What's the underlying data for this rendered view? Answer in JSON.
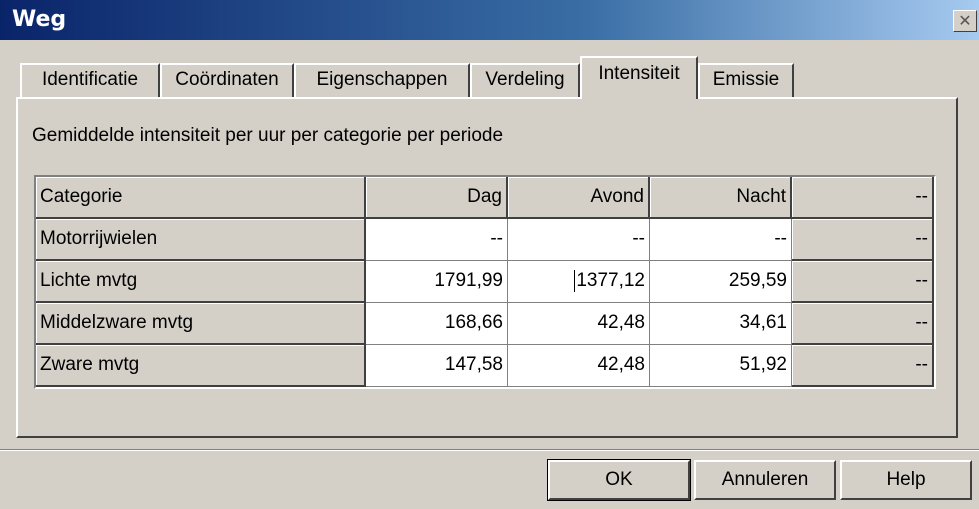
{
  "window": {
    "title": "Weg",
    "close_glyph": "✕"
  },
  "tabs": [
    {
      "label": "Identificatie",
      "active": false
    },
    {
      "label": "Coördinaten",
      "active": false
    },
    {
      "label": "Eigenschappen",
      "active": false
    },
    {
      "label": "Verdeling",
      "active": false
    },
    {
      "label": "Intensiteit",
      "active": true
    },
    {
      "label": "Emissie",
      "active": false
    }
  ],
  "panel": {
    "caption": "Gemiddelde intensiteit per uur per categorie per periode"
  },
  "table": {
    "headers": [
      "Categorie",
      "Dag",
      "Avond",
      "Nacht",
      "--"
    ],
    "rows": [
      {
        "category": "Motorrijwielen",
        "values": [
          "--",
          "--",
          "--",
          "--"
        ]
      },
      {
        "category": "Lichte mvtg",
        "values": [
          "1791,99",
          "1377,12",
          "259,59",
          "--"
        ]
      },
      {
        "category": "Middelzware mvtg",
        "values": [
          "168,66",
          "42,48",
          "34,61",
          "--"
        ]
      },
      {
        "category": "Zware mvtg",
        "values": [
          "147,58",
          "42,48",
          "51,92",
          "--"
        ]
      }
    ]
  },
  "buttons": {
    "ok": "OK",
    "cancel": "Annuleren",
    "help": "Help"
  },
  "colors": {
    "titlebar_start": "#0a246a",
    "titlebar_end": "#a6caf0",
    "face": "#d4d0c8"
  }
}
